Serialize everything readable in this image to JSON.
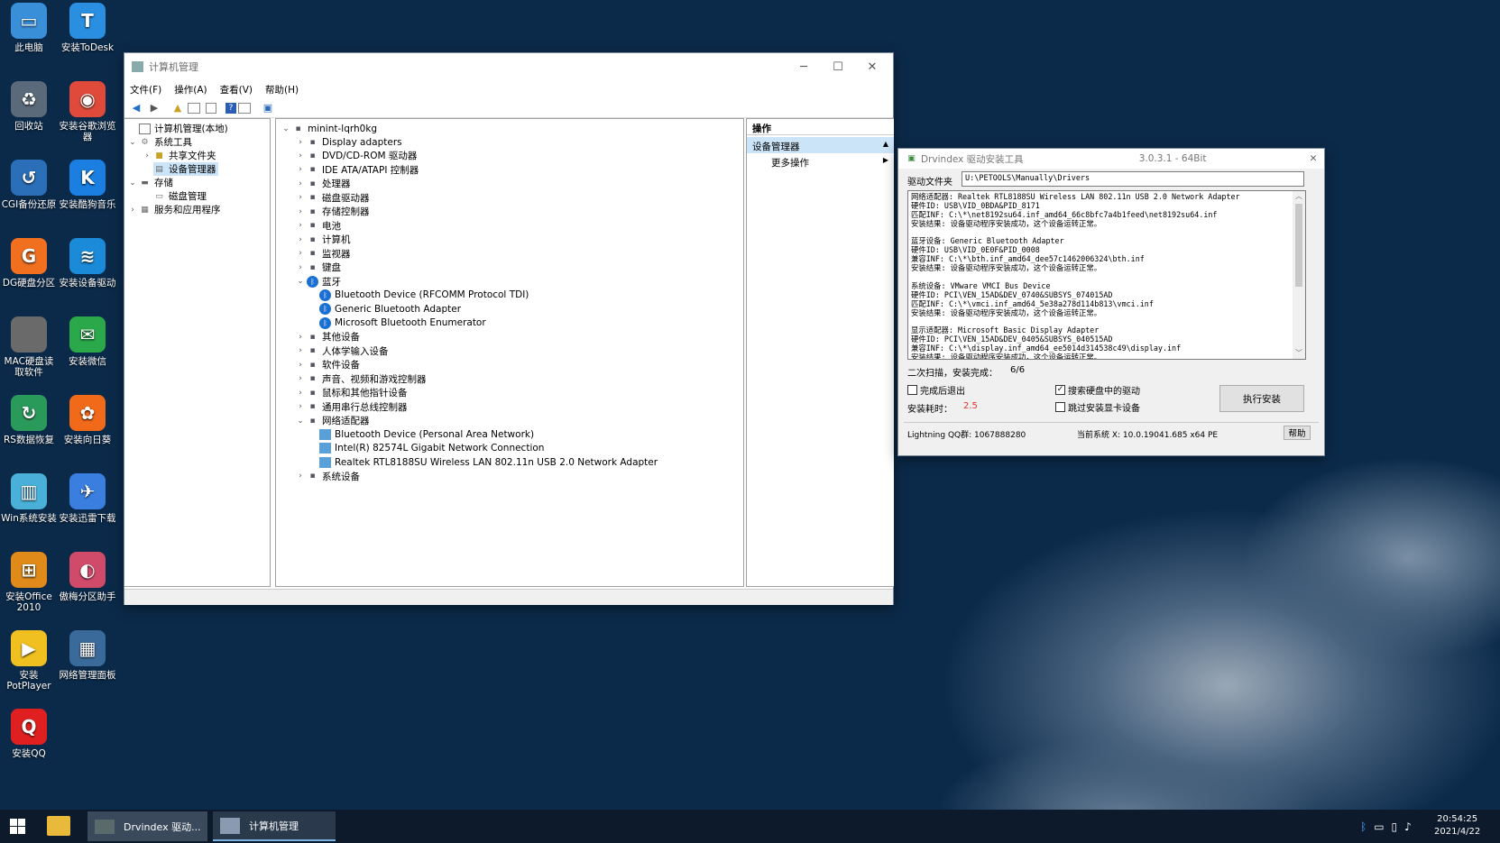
{
  "desktop_icons": [
    {
      "label": "此电脑",
      "icon": "computer-icon"
    },
    {
      "label": "安装ToDesk",
      "icon": "todesk-icon"
    },
    {
      "label": "回收站",
      "icon": "recycle-bin-icon"
    },
    {
      "label": "安装谷歌浏览器",
      "icon": "chrome-icon"
    },
    {
      "label": "CGI备份还原",
      "icon": "cgi-icon"
    },
    {
      "label": "安装酷狗音乐",
      "icon": "kugou-icon"
    },
    {
      "label": "DG硬盘分区",
      "icon": "diskgenius-icon"
    },
    {
      "label": "安装设备驱动",
      "icon": "wifi-icon"
    },
    {
      "label": "MAC硬盘读取软件",
      "icon": "mac-disk-icon"
    },
    {
      "label": "安装微信",
      "icon": "wechat-icon"
    },
    {
      "label": "RS数据恢复",
      "icon": "rs-recovery-icon"
    },
    {
      "label": "安装向日葵",
      "icon": "sunflower-icon"
    },
    {
      "label": "Win系统安装",
      "icon": "win-setup-icon"
    },
    {
      "label": "安装迅雷下载",
      "icon": "xunlei-icon"
    },
    {
      "label": "安装Office 2010",
      "icon": "office-icon"
    },
    {
      "label": "傲梅分区助手",
      "icon": "aomei-icon"
    },
    {
      "label": "安装PotPlayer",
      "icon": "potplayer-icon"
    },
    {
      "label": "网络管理面板",
      "icon": "network-panel-icon"
    },
    {
      "label": "安装QQ",
      "icon": "qq-icon"
    }
  ],
  "cm": {
    "title": "计算机管理",
    "menu": [
      "文件(F)",
      "操作(A)",
      "查看(V)",
      "帮助(H)"
    ],
    "tree": [
      "计算机管理(本地)",
      "系统工具",
      "共享文件夹",
      "设备管理器",
      "存储",
      "磁盘管理",
      "服务和应用程序"
    ],
    "devices": {
      "root": "minint-lqrh0kg",
      "items": [
        "Display adapters",
        "DVD/CD-ROM 驱动器",
        "IDE ATA/ATAPI 控制器",
        "处理器",
        "磁盘驱动器",
        "存储控制器",
        "电池",
        "计算机",
        "监视器",
        "键盘",
        "蓝牙",
        "Bluetooth Device (RFCOMM Protocol TDI)",
        "Generic Bluetooth Adapter",
        "Microsoft Bluetooth Enumerator",
        "其他设备",
        "人体学输入设备",
        "软件设备",
        "声音、视频和游戏控制器",
        "鼠标和其他指针设备",
        "通用串行总线控制器",
        "网络适配器",
        "Bluetooth Device (Personal Area Network)",
        "Intel(R) 82574L Gigabit Network Connection",
        "Realtek RTL8188SU Wireless LAN 802.11n USB 2.0 Network Adapter",
        "系统设备"
      ]
    },
    "actions": {
      "header": "操作",
      "section": "设备管理器",
      "more": "更多操作"
    }
  },
  "dr": {
    "title": "Drvindex  驱动安装工具",
    "version": "3.0.3.1 - 64Bit",
    "folder_label": "驱动文件夹",
    "folder_value": "U:\\PETOOLS\\Manually\\Drivers",
    "log": [
      "网络适配器: Realtek RTL8188SU Wireless LAN 802.11n USB 2.0 Network Adapter",
      "硬件ID:   USB\\VID_0BDA&PID_8171",
      "匹配INF:  C:\\*\\net8192su64.inf_amd64_66c8bfc7a4b1feed\\net8192su64.inf",
      "安装结果: 设备驱动程序安装成功，这个设备运转正常。",
      "",
      "蓝牙设备: Generic Bluetooth Adapter",
      "硬件ID:   USB\\VID_0E0F&PID_0008",
      "兼容INF:  C:\\*\\bth.inf_amd64_dee57c1462006324\\bth.inf",
      "安装结果: 设备驱动程序安装成功，这个设备运转正常。",
      "",
      "系统设备: VMware VMCI Bus Device",
      "硬件ID:   PCI\\VEN_15AD&DEV_0740&SUBSYS_074015AD",
      "匹配INF:  C:\\*\\vmci.inf_amd64_5e38a278d114b813\\vmci.inf",
      "安装结果: 设备驱动程序安装成功，这个设备运转正常。",
      "",
      "显示适配器: Microsoft Basic Display Adapter",
      "硬件ID:   PCI\\VEN_15AD&DEV_0405&SUBSYS_040515AD",
      "兼容INF:  C:\\*\\display.inf_amd64_ee5014d314538c49\\display.inf",
      "安装结果: 设备驱动程序安装成功，这个设备运转正常。"
    ],
    "scan_label": "二次扫描，安装完成：",
    "scan_value": "6/6",
    "chk_exit": "完成后退出",
    "chk_search": "搜索硬盘中的驱动",
    "time_label": "安装耗时：",
    "time_value": "2.5",
    "chk_skip": "跳过安装显卡设备",
    "install_btn": "执行安装",
    "footer_author": "Lightning  QQ群: 1067888280",
    "footer_sys": "当前系统 X: 10.0.19041.685 x64  PE",
    "help_btn": "帮助"
  },
  "taskbar": {
    "app1": "Drvindex  驱动...",
    "app2": "计算机管理",
    "time": "20:54:25",
    "date": "2021/4/22"
  },
  "colors": {
    "desktop": "#0b2a4a",
    "taskbar": "#0c1a2b",
    "selection": "#cce4f7",
    "bluetooth": "#1a6fd3",
    "time_value": "#e03030"
  }
}
